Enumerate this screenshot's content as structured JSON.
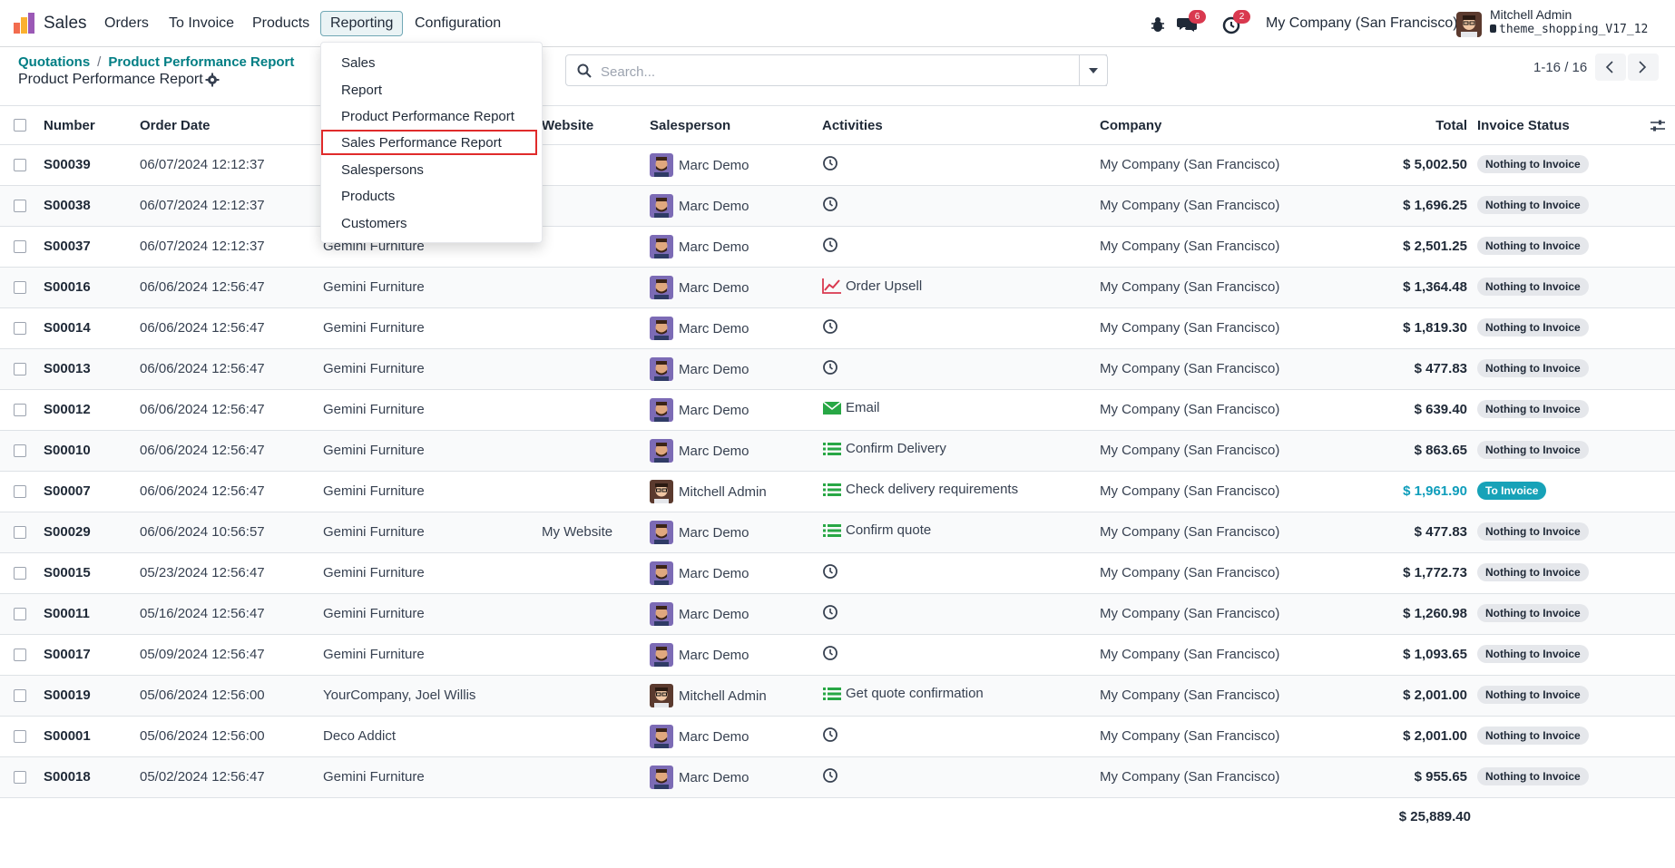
{
  "navbar": {
    "app_name": "Sales",
    "menus": [
      "Orders",
      "To Invoice",
      "Products",
      "Reporting",
      "Configuration"
    ],
    "active_menu": "Reporting",
    "messages_count": "6",
    "activities_count": "2",
    "company": "My Company (San Francisco)",
    "user_name": "Mitchell Admin",
    "database": "theme_shopping_V17_12"
  },
  "control_panel": {
    "breadcrumb": [
      "Quotations",
      "Product Performance Report"
    ],
    "page_title": "Product Performance Report",
    "search_placeholder": "Search...",
    "pager": "1-16 / 16"
  },
  "reporting_menu": {
    "items": [
      "Sales",
      "Report",
      "Product Performance Report",
      "Sales Performance Report",
      "Salespersons",
      "Products",
      "Customers"
    ],
    "highlighted": "Sales Performance Report"
  },
  "columns": [
    "Number",
    "Order Date",
    "Website",
    "Salesperson",
    "Activities",
    "Company",
    "Total",
    "Invoice Status"
  ],
  "rows": [
    {
      "number": "S00039",
      "date": "06/07/2024 12:12:37",
      "customer": "",
      "website": "",
      "salesperson": "Marc Demo",
      "activity": "",
      "activity_icon": "clock-icon",
      "company": "My Company (San Francisco)",
      "total": "$ 5,002.50",
      "status": "Nothing to Invoice"
    },
    {
      "number": "S00038",
      "date": "06/07/2024 12:12:37",
      "customer": "",
      "website": "",
      "salesperson": "Marc Demo",
      "activity": "",
      "activity_icon": "clock-icon",
      "company": "My Company (San Francisco)",
      "total": "$ 1,696.25",
      "status": "Nothing to Invoice"
    },
    {
      "number": "S00037",
      "date": "06/07/2024 12:12:37",
      "customer": "Gemini Furniture",
      "website": "",
      "salesperson": "Marc Demo",
      "activity": "",
      "activity_icon": "clock-icon",
      "company": "My Company (San Francisco)",
      "total": "$ 2,501.25",
      "status": "Nothing to Invoice"
    },
    {
      "number": "S00016",
      "date": "06/06/2024 12:56:47",
      "customer": "Gemini Furniture",
      "website": "",
      "salesperson": "Marc Demo",
      "activity": "Order Upsell",
      "activity_icon": "trend-chart-icon",
      "company": "My Company (San Francisco)",
      "total": "$ 1,364.48",
      "status": "Nothing to Invoice"
    },
    {
      "number": "S00014",
      "date": "06/06/2024 12:56:47",
      "customer": "Gemini Furniture",
      "website": "",
      "salesperson": "Marc Demo",
      "activity": "",
      "activity_icon": "clock-icon",
      "company": "My Company (San Francisco)",
      "total": "$ 1,819.30",
      "status": "Nothing to Invoice"
    },
    {
      "number": "S00013",
      "date": "06/06/2024 12:56:47",
      "customer": "Gemini Furniture",
      "website": "",
      "salesperson": "Marc Demo",
      "activity": "",
      "activity_icon": "clock-icon",
      "company": "My Company (San Francisco)",
      "total": "$ 477.83",
      "status": "Nothing to Invoice"
    },
    {
      "number": "S00012",
      "date": "06/06/2024 12:56:47",
      "customer": "Gemini Furniture",
      "website": "",
      "salesperson": "Marc Demo",
      "activity": "Email",
      "activity_icon": "email-icon",
      "company": "My Company (San Francisco)",
      "total": "$ 639.40",
      "status": "Nothing to Invoice"
    },
    {
      "number": "S00010",
      "date": "06/06/2024 12:56:47",
      "customer": "Gemini Furniture",
      "website": "",
      "salesperson": "Marc Demo",
      "activity": "Confirm Delivery",
      "activity_icon": "task-list-icon",
      "company": "My Company (San Francisco)",
      "total": "$ 863.65",
      "status": "Nothing to Invoice"
    },
    {
      "number": "S00007",
      "date": "06/06/2024 12:56:47",
      "customer": "Gemini Furniture",
      "website": "",
      "salesperson": "Mitchell Admin",
      "activity": "Check delivery requirements",
      "activity_icon": "task-list-icon",
      "company": "My Company (San Francisco)",
      "total": "$ 1,961.90",
      "status": "To Invoice"
    },
    {
      "number": "S00029",
      "date": "06/06/2024 10:56:57",
      "customer": "Gemini Furniture",
      "website": "My Website",
      "salesperson": "Marc Demo",
      "activity": "Confirm quote",
      "activity_icon": "task-list-icon",
      "company": "My Company (San Francisco)",
      "total": "$ 477.83",
      "status": "Nothing to Invoice"
    },
    {
      "number": "S00015",
      "date": "05/23/2024 12:56:47",
      "customer": "Gemini Furniture",
      "website": "",
      "salesperson": "Marc Demo",
      "activity": "",
      "activity_icon": "clock-icon",
      "company": "My Company (San Francisco)",
      "total": "$ 1,772.73",
      "status": "Nothing to Invoice"
    },
    {
      "number": "S00011",
      "date": "05/16/2024 12:56:47",
      "customer": "Gemini Furniture",
      "website": "",
      "salesperson": "Marc Demo",
      "activity": "",
      "activity_icon": "clock-icon",
      "company": "My Company (San Francisco)",
      "total": "$ 1,260.98",
      "status": "Nothing to Invoice"
    },
    {
      "number": "S00017",
      "date": "05/09/2024 12:56:47",
      "customer": "Gemini Furniture",
      "website": "",
      "salesperson": "Marc Demo",
      "activity": "",
      "activity_icon": "clock-icon",
      "company": "My Company (San Francisco)",
      "total": "$ 1,093.65",
      "status": "Nothing to Invoice"
    },
    {
      "number": "S00019",
      "date": "05/06/2024 12:56:00",
      "customer": "YourCompany, Joel Willis",
      "website": "",
      "salesperson": "Mitchell Admin",
      "activity": "Get quote confirmation",
      "activity_icon": "task-list-icon",
      "company": "My Company (San Francisco)",
      "total": "$ 2,001.00",
      "status": "Nothing to Invoice"
    },
    {
      "number": "S00001",
      "date": "05/06/2024 12:56:00",
      "customer": "Deco Addict",
      "website": "",
      "salesperson": "Marc Demo",
      "activity": "",
      "activity_icon": "clock-icon",
      "company": "My Company (San Francisco)",
      "total": "$ 2,001.00",
      "status": "Nothing to Invoice"
    },
    {
      "number": "S00018",
      "date": "05/02/2024 12:56:47",
      "customer": "Gemini Furniture",
      "website": "",
      "salesperson": "Marc Demo",
      "activity": "",
      "activity_icon": "clock-icon",
      "company": "My Company (San Francisco)",
      "total": "$ 955.65",
      "status": "Nothing to Invoice"
    }
  ],
  "grand_total": "$ 25,889.40",
  "colors": {
    "accent": "#017e84",
    "highlight_border": "#e02b2b",
    "to_invoice": "#17a2b8",
    "badge_red": "#d9394f"
  }
}
